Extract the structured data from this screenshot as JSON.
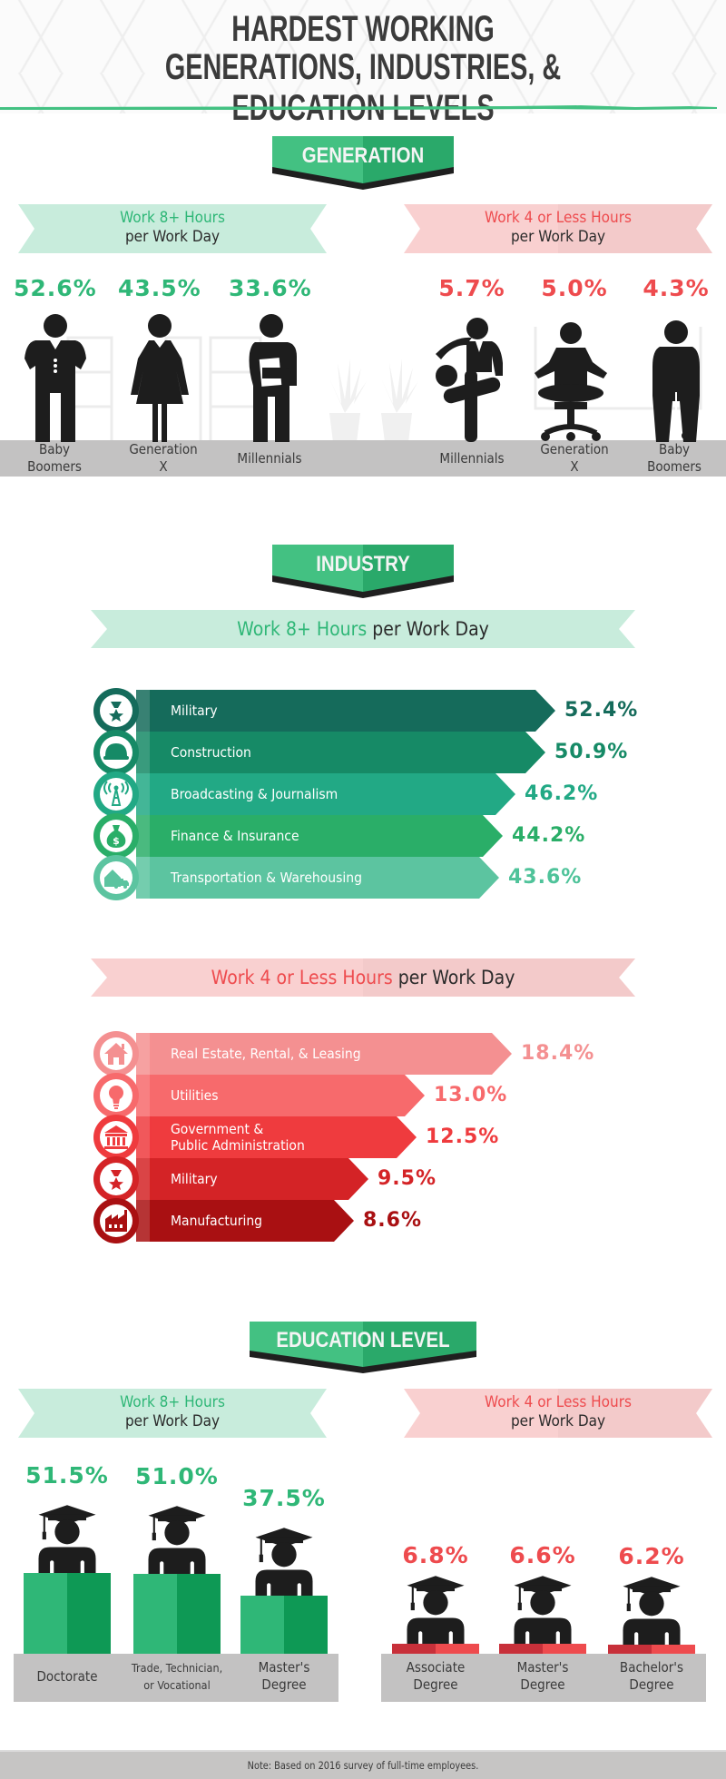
{
  "title": {
    "line1": "Hardest Working",
    "line2": "Generations, Industries, & Education Levels"
  },
  "colors": {
    "green": "#2fb777",
    "red": "#ee4b4e",
    "banner_green": "#3dbd7d",
    "dark": "#1d1d1d",
    "floor_gray": "#c3c2c2"
  },
  "generation": {
    "banner": "GENERATION",
    "left_ribbon": {
      "highlight": "Work 8+ Hours",
      "rest": "per Work Day"
    },
    "right_ribbon": {
      "highlight": "Work 4 or Less Hours",
      "rest": "per Work Day"
    },
    "work_8_plus": [
      {
        "label_line1": "Baby",
        "label_line2": "Boomers",
        "value": "52.6%",
        "icon": "businessman-hands-on-hips-icon"
      },
      {
        "label_line1": "Generation",
        "label_line2": "X",
        "value": "43.5%",
        "icon": "businesswoman-icon"
      },
      {
        "label_line1": "Millennials",
        "label_line2": "",
        "value": "33.6%",
        "icon": "person-holding-document-icon"
      }
    ],
    "work_4_or_less": [
      {
        "label_line1": "Millennials",
        "label_line2": "",
        "value": "5.7%",
        "icon": "person-kicking-ball-icon"
      },
      {
        "label_line1": "Generation",
        "label_line2": "X",
        "value": "5.0%",
        "icon": "person-meditating-on-chair-icon"
      },
      {
        "label_line1": "Baby",
        "label_line2": "Boomers",
        "value": "4.3%",
        "icon": "person-golfing-icon"
      }
    ]
  },
  "industry": {
    "banner": "INDUSTRY",
    "top_ribbon": {
      "highlight": "Work 8+ Hours",
      "rest": "per Work Day"
    },
    "bottom_ribbon": {
      "highlight": "Work 4 or Less Hours",
      "rest": "per Work Day"
    },
    "work_8_plus": [
      {
        "label": "Military",
        "value": "52.4%",
        "icon": "medal-icon",
        "color": "#156b5b"
      },
      {
        "label": "Construction",
        "value": "50.9%",
        "icon": "hard-hat-icon",
        "color": "#168a66"
      },
      {
        "label": "Broadcasting & Journalism",
        "value": "46.2%",
        "icon": "radio-tower-icon",
        "color": "#22a985"
      },
      {
        "label": "Finance & Insurance",
        "value": "44.2%",
        "icon": "money-bag-icon",
        "color": "#2aae68"
      },
      {
        "label": "Transportation & Warehousing",
        "value": "43.6%",
        "icon": "house-and-truck-icon",
        "color": "#5cc4a0"
      }
    ],
    "work_4_or_less": [
      {
        "label": "Real Estate, Rental, & Leasing",
        "value": "18.4%",
        "icon": "house-icon",
        "color": "#f49091"
      },
      {
        "label": "Utilities",
        "value": "13.0%",
        "icon": "light-bulb-icon",
        "color": "#f76a6c"
      },
      {
        "label_line1": "Government &",
        "label_line2": "Public Administration",
        "label": "Government & Public Administration",
        "value": "12.5%",
        "icon": "government-building-icon",
        "color": "#ef3b3e"
      },
      {
        "label": "Military",
        "value": "9.5%",
        "icon": "medal-icon",
        "color": "#d42326"
      },
      {
        "label": "Manufacturing",
        "value": "8.6%",
        "icon": "factory-icon",
        "color": "#a91012"
      }
    ]
  },
  "education": {
    "banner": "EDUCATION LEVEL",
    "left_ribbon": {
      "highlight": "Work 8+ Hours",
      "rest": "per Work Day"
    },
    "right_ribbon": {
      "highlight": "Work 4 or Less Hours",
      "rest": "per Work Day"
    },
    "work_8_plus": [
      {
        "label_line1": "Doctorate",
        "label_line2": "",
        "value": "51.5%"
      },
      {
        "label_line1": "Trade, Technician,",
        "label_line2": "or Vocational",
        "value": "51.0%"
      },
      {
        "label_line1": "Master's",
        "label_line2": "Degree",
        "value": "37.5%"
      }
    ],
    "work_4_or_less": [
      {
        "label_line1": "Associate",
        "label_line2": "Degree",
        "value": "6.8%"
      },
      {
        "label_line1": "Master's",
        "label_line2": "Degree",
        "value": "6.6%"
      },
      {
        "label_line1": "Bachelor's",
        "label_line2": "Degree",
        "value": "6.2%"
      }
    ]
  },
  "footer": {
    "note": "Note: Based on 2016 survey of full-time employees."
  },
  "chart_data": [
    {
      "type": "bar",
      "title": "Generation — Work 8+ Hours per Work Day",
      "categories": [
        "Baby Boomers",
        "Generation X",
        "Millennials"
      ],
      "values": [
        52.6,
        43.5,
        33.6
      ],
      "unit": "%"
    },
    {
      "type": "bar",
      "title": "Generation — Work 4 or Less Hours per Work Day",
      "categories": [
        "Millennials",
        "Generation X",
        "Baby Boomers"
      ],
      "values": [
        5.7,
        5.0,
        4.3
      ],
      "unit": "%"
    },
    {
      "type": "bar",
      "orientation": "horizontal",
      "title": "Industry — Work 8+ Hours per Work Day",
      "categories": [
        "Military",
        "Construction",
        "Broadcasting & Journalism",
        "Finance & Insurance",
        "Transportation & Warehousing"
      ],
      "values": [
        52.4,
        50.9,
        46.2,
        44.2,
        43.6
      ],
      "unit": "%"
    },
    {
      "type": "bar",
      "orientation": "horizontal",
      "title": "Industry — Work 4 or Less Hours per Work Day",
      "categories": [
        "Real Estate, Rental, & Leasing",
        "Utilities",
        "Government & Public Administration",
        "Military",
        "Manufacturing"
      ],
      "values": [
        18.4,
        13.0,
        12.5,
        9.5,
        8.6
      ],
      "unit": "%"
    },
    {
      "type": "bar",
      "title": "Education Level — Work 8+ Hours per Work Day",
      "categories": [
        "Doctorate",
        "Trade, Technician, or Vocational",
        "Master's Degree"
      ],
      "values": [
        51.5,
        51.0,
        37.5
      ],
      "unit": "%"
    },
    {
      "type": "bar",
      "title": "Education Level — Work 4 or Less Hours per Work Day",
      "categories": [
        "Associate Degree",
        "Master's Degree",
        "Bachelor's Degree"
      ],
      "values": [
        6.8,
        6.6,
        6.2
      ],
      "unit": "%"
    }
  ]
}
